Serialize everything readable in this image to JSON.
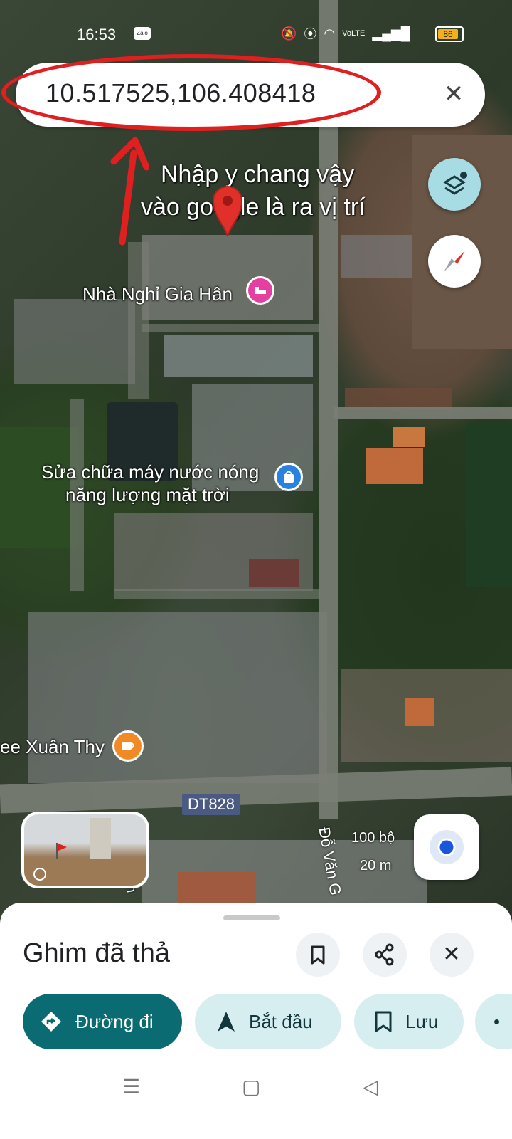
{
  "status_bar": {
    "time": "16:53",
    "app_badge": "Zalo",
    "network_label": "VoLTE",
    "battery": "86"
  },
  "search": {
    "value": "10.517525,106.408418"
  },
  "annotation": {
    "line1": "Nhập y chang vậy",
    "line2": "vào google là ra vị trí"
  },
  "places": {
    "guesthouse": "Nhà Nghỉ Gia Hân",
    "repair_line1": "Sửa chữa máy nước nóng",
    "repair_line2": "năng lượng mặt trời",
    "cafe": "ee Xuân Thy"
  },
  "road_label": "DT828",
  "street_label": "Đỗ Văn G",
  "street_label2": "ăn",
  "scale": {
    "feet": "100 bộ",
    "meters": "20 m"
  },
  "sheet": {
    "title": "Ghim đã thả",
    "actions": [
      {
        "label": "Đường đi",
        "icon": "directions-icon"
      },
      {
        "label": "Bắt đầu",
        "icon": "navigation-arrow-icon"
      },
      {
        "label": "Lưu",
        "icon": "bookmark-icon"
      }
    ]
  },
  "colors": {
    "accent": "#0b6b72",
    "chip_bg": "#d7eef1",
    "annotation_red": "#e02020"
  }
}
